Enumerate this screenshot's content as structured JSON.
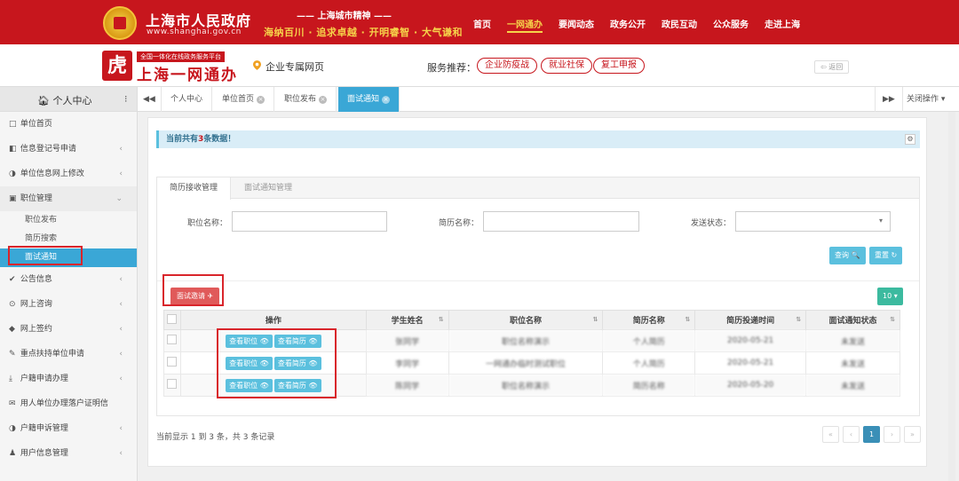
{
  "gov": {
    "title": "上海市人民政府",
    "url": "www.shanghai.gov.cn",
    "spirit_title": "—— 上海城市精神 ——",
    "spirit_text": "海纳百川 · 追求卓越 · 开明睿智 · 大气谦和"
  },
  "topnav": [
    "首页",
    "一网通办",
    "要闻动态",
    "政务公开",
    "政民互动",
    "公众服务",
    "走进上海"
  ],
  "topnav_active": 1,
  "platform": {
    "logo_glyph": "虎",
    "tag": "全国一体化在线政务服务平台",
    "name": "上海一网通办",
    "page": "企业专属网页",
    "service_label": "服务推荐：",
    "services": [
      "企业防疫战",
      "就业社保",
      "复工申报"
    ],
    "back": "返回"
  },
  "sidebar": {
    "header": "个人中心",
    "items": [
      {
        "label": "单位首页",
        "icon": "□",
        "chev": ""
      },
      {
        "label": "信息登记号申请",
        "icon": "◧",
        "chev": "‹"
      },
      {
        "label": "单位信息网上修改",
        "icon": "◑",
        "chev": "‹"
      },
      {
        "label": "职位管理",
        "icon": "▣",
        "chev": "⌄"
      }
    ],
    "sub_items": [
      "职位发布",
      "简历搜索",
      "面试通知"
    ],
    "items2": [
      {
        "label": "公告信息",
        "icon": "✔",
        "chev": "‹"
      },
      {
        "label": "网上咨询",
        "icon": "⊙",
        "chev": "‹"
      },
      {
        "label": "网上签约",
        "icon": "◆",
        "chev": "‹"
      },
      {
        "label": "重点扶持单位申请",
        "icon": "✎",
        "chev": "‹"
      },
      {
        "label": "户籍申请办理",
        "icon": "⤓",
        "chev": "‹"
      },
      {
        "label": "用人单位办理落户证明信",
        "icon": "✉",
        "chev": ""
      },
      {
        "label": "户籍申诉管理",
        "icon": "◑",
        "chev": "‹"
      },
      {
        "label": "用户信息管理",
        "icon": "♟",
        "chev": "‹"
      }
    ]
  },
  "tabs": {
    "prev": "◀◀",
    "items": [
      "个人中心",
      "单位首页",
      "职位发布",
      "面试通知"
    ],
    "next": "▶▶",
    "close_ops": "关闭操作 ▾"
  },
  "alert": {
    "prefix": "当前共有",
    "count": "3",
    "suffix": "条数据！"
  },
  "panel": {
    "tabs": [
      "简历接收管理",
      "面试通知管理"
    ],
    "labels": {
      "position": "职位名称：",
      "resume": "简历名称：",
      "status": "发送状态："
    },
    "search": "查询 🔍",
    "reset": "重置 ↻",
    "invite": "面试邀请 ✈",
    "pagesize": "10 ▾"
  },
  "table": {
    "headers": [
      "操作",
      "学生姓名",
      "职位名称",
      "简历名称",
      "简历投递时间",
      "面试通知状态"
    ],
    "op_view_position": "查看职位 👁",
    "op_view_resume": "查看简历 👁",
    "rows": [
      [
        "张同学",
        "职位名称演示",
        "个人简历",
        "2020-05-21",
        "未发送"
      ],
      [
        "李同学",
        "一网通办临时测试职位",
        "个人简历",
        "2020-05-21",
        "未发送"
      ],
      [
        "陈同学",
        "职位名称演示",
        "简历名称",
        "2020-05-20",
        "未发送"
      ]
    ]
  },
  "pager": {
    "text": "当前显示 1 到 3 条，共 3 条记录",
    "first": "«",
    "prev": "‹",
    "current": "1",
    "next": "›",
    "last": "»"
  }
}
